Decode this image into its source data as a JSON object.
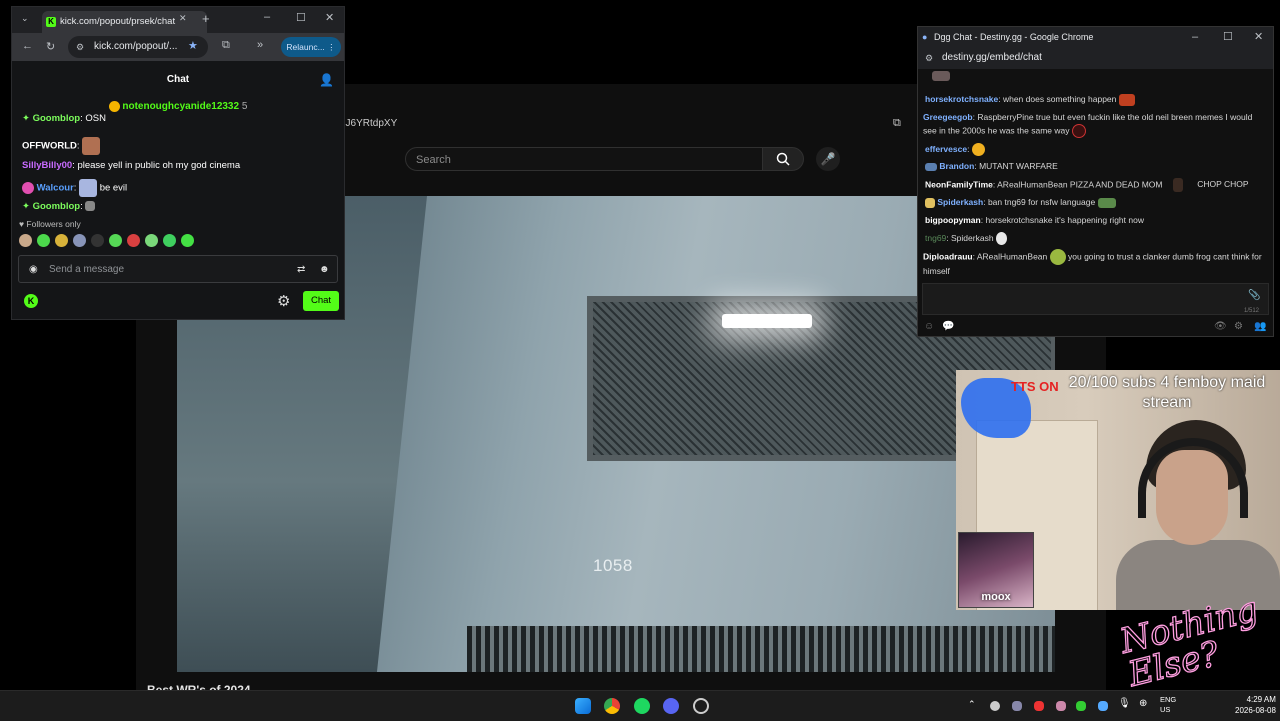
{
  "background_browser": {
    "url_fragment": "dJ6YRtdpXY",
    "search_placeholder": "Search",
    "video_counter": "1058",
    "caption": "Best WR's of 2024"
  },
  "kick_window": {
    "tab_title": "kick.com/popout/prsek/chat",
    "address": "kick.com/popout/...",
    "relaunch_label": "Relaunc...",
    "header_title": "Chat",
    "pinned_user": "notenoughcyanide12332",
    "pinned_count": "5",
    "messages": [
      {
        "user": "Goomblop",
        "text": "OSN",
        "color": "#7cfc5c"
      },
      {
        "user": "OFFWORLD",
        "text": "",
        "color": "#ffffff"
      },
      {
        "user": "SillyBilly00",
        "text": "please yell in public oh my god cinema",
        "color": "#c86bff"
      },
      {
        "user": "Walcour",
        "text": "be evil",
        "color": "#5aa0ff"
      },
      {
        "user": "Goomblop",
        "text": "",
        "color": "#7cfc5c"
      }
    ],
    "followers_only": "Followers only",
    "input_placeholder": "Send a message",
    "chat_button": "Chat"
  },
  "dgg_window": {
    "title": "Dgg Chat - Destiny.gg - Google Chrome",
    "url": "destiny.gg/embed/chat",
    "char_count": "1/512",
    "messages": [
      {
        "user": "horsekrotchsnake",
        "text": "when does something happen",
        "color": "#7fb1ff"
      },
      {
        "user": "Greegeegob",
        "text": "RaspberryPine true but even fuckin like the old neil breen memes I would see in the 2000s he was the same way",
        "color": "#7fb1ff"
      },
      {
        "user": "effervesce",
        "text": "",
        "color": "#7fb1ff"
      },
      {
        "user": "Brandon",
        "text": "MUTANT WARFARE",
        "color": "#7fb1ff"
      },
      {
        "user": "NeonFamilyTime",
        "text": "ARealHumanBean PIZZA AND DEAD MOM",
        "extra": "CHOP CHOP",
        "color": "#ffffff"
      },
      {
        "user": "Spiderkash",
        "text": "ban tng69 for nsfw language",
        "color": "#7fb1ff"
      },
      {
        "user": "bigpoopyman",
        "text": "horsekrotchsnake it's happening right now",
        "color": "#ffffff"
      },
      {
        "user": "tng69",
        "text": "Spiderkash",
        "color": "#5a8a5a"
      },
      {
        "user": "Diploadrauu",
        "text": "ARealHumanBean",
        "extra": "you going to trust a clanker dumb frog cant think for himself",
        "color": "#ffffff"
      }
    ]
  },
  "overlay": {
    "subs_goal": "20/100 subs 4 femboy maid stream",
    "tts_label": "TTS ON",
    "moox_label": "moox",
    "nothing_else": "Nothing\nElse?"
  },
  "taskbar": {
    "lang": "ENG",
    "region": "US",
    "time": "4:29 AM",
    "date": "2026-08-08"
  }
}
